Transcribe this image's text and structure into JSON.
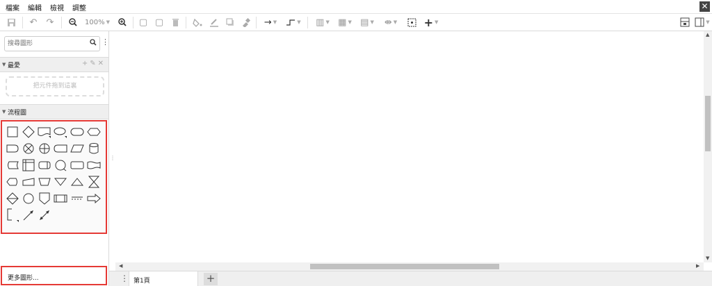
{
  "menubar": {
    "items": [
      "檔案",
      "編輯",
      "檢視",
      "調整"
    ],
    "close_label": "✕"
  },
  "toolbar": {
    "zoom": "100%",
    "icons": [
      "save-icon",
      "undo-icon",
      "redo-icon",
      "zoom-out-icon",
      "zoom-in-icon",
      "bring-front-icon",
      "send-back-icon",
      "delete-icon",
      "fill-color-icon",
      "line-color-icon",
      "shadow-icon",
      "format-painter-icon",
      "connection-icon",
      "waypoints-icon",
      "align-icon",
      "arrange-icon",
      "distribute-icon",
      "group-icon",
      "select-icon",
      "insert-icon",
      "format-panel-icon",
      "outline-icon"
    ]
  },
  "sidebar": {
    "search_placeholder": "搜尋圖形",
    "scratchpad": {
      "title": "最愛",
      "drop_hint": "把元件拖到這裏"
    },
    "flowchart": {
      "title": "流程圖",
      "shapes": [
        "process",
        "decision",
        "document",
        "terminator-oval",
        "rounded-rect",
        "preparation",
        "delay",
        "summing-junction",
        "or",
        "data-storage",
        "data",
        "direct-storage",
        "stored-data",
        "internal-storage",
        "sequential-storage",
        "connector",
        "card",
        "punched-tape",
        "display",
        "manual-input",
        "manual-operation",
        "extract",
        "merge",
        "collate",
        "sort",
        "start-circle",
        "off-page-connector",
        "predefined-process",
        "annotation",
        "transfer-arrow",
        "annotation-bracket",
        "line-arrow",
        "line-bidirectional"
      ]
    },
    "more_shapes": "更多圖形..."
  },
  "pages": {
    "tab_label": "第1頁",
    "add_label": "+"
  },
  "colors": {
    "highlight": "#e53935",
    "panel": "#efefef"
  }
}
